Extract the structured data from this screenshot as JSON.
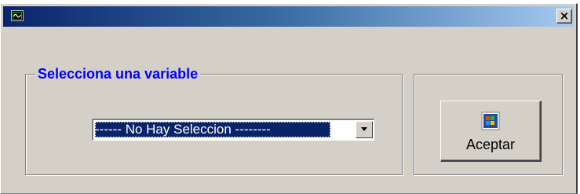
{
  "window": {
    "title": "",
    "app_icon": "graph-icon",
    "close_label": "×"
  },
  "variable_group": {
    "title": "Selecciona una variable",
    "select": {
      "selected": "------ No Hay Seleccion --------"
    }
  },
  "actions": {
    "accept_label": "Aceptar",
    "accept_icon": "windows-logo-icon"
  },
  "colors": {
    "group_title": "#0000ff",
    "selection_bg": "#0a246a",
    "titlebar_start": "#0a246a",
    "titlebar_end": "#a6caf0",
    "face": "#d4d0c8"
  }
}
